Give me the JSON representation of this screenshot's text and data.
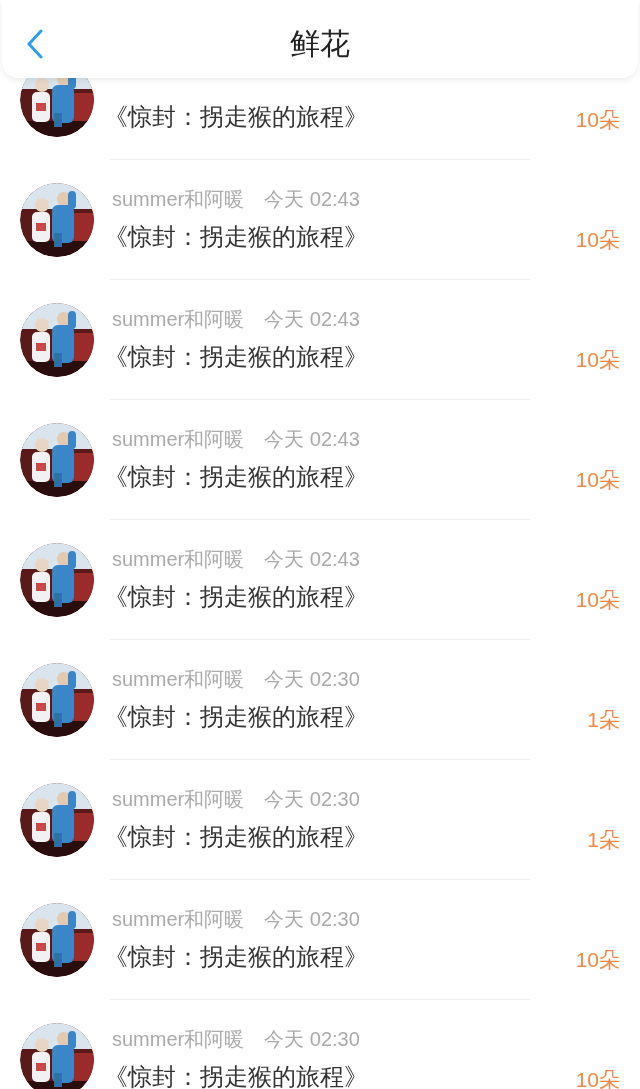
{
  "header": {
    "title": "鲜花"
  },
  "rows": [
    {
      "title": "《惊封：拐走猴的旅程》",
      "count": "10朵"
    },
    {
      "name": "summer和阿暖",
      "time": "今天 02:43",
      "title": "《惊封：拐走猴的旅程》",
      "count": "10朵"
    },
    {
      "name": "summer和阿暖",
      "time": "今天 02:43",
      "title": "《惊封：拐走猴的旅程》",
      "count": "10朵"
    },
    {
      "name": "summer和阿暖",
      "time": "今天 02:43",
      "title": "《惊封：拐走猴的旅程》",
      "count": "10朵"
    },
    {
      "name": "summer和阿暖",
      "time": "今天 02:43",
      "title": "《惊封：拐走猴的旅程》",
      "count": "10朵"
    },
    {
      "name": "summer和阿暖",
      "time": "今天 02:30",
      "title": "《惊封：拐走猴的旅程》",
      "count": "1朵"
    },
    {
      "name": "summer和阿暖",
      "time": "今天 02:30",
      "title": "《惊封：拐走猴的旅程》",
      "count": "1朵"
    },
    {
      "name": "summer和阿暖",
      "time": "今天 02:30",
      "title": "《惊封：拐走猴的旅程》",
      "count": "10朵"
    },
    {
      "name": "summer和阿暖",
      "time": "今天 02:30",
      "title": "《惊封：拐走猴的旅程》",
      "count": "10朵"
    }
  ]
}
